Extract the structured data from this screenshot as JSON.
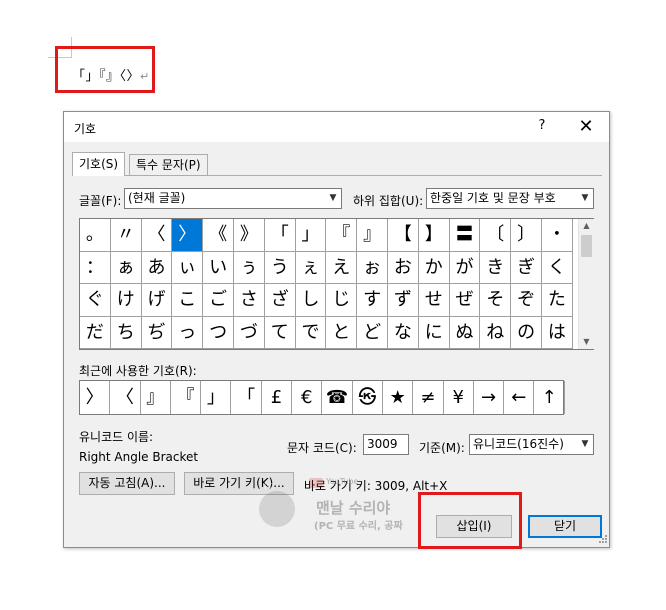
{
  "document": {
    "inserted_text": "「」『』〈〉",
    "paragraph_mark": "↵"
  },
  "dialog": {
    "title": "기호",
    "help": "?",
    "close": "✕",
    "tabs": [
      {
        "label": "기호(S)",
        "active": true
      },
      {
        "label": "특수 문자(P)",
        "active": false
      }
    ],
    "font_label": "글꼴(F):",
    "font_value": "(현재 글꼴)",
    "subset_label": "하위 집합(U):",
    "subset_value": "한중일 기호 및 문장 부호",
    "symbols": [
      [
        "。",
        "〃",
        "〈",
        "〉",
        "《",
        "》",
        "「",
        "」",
        "『",
        "』",
        "【",
        "】",
        "〓",
        "〔",
        "〕",
        "・"
      ],
      [
        "：",
        "ぁ",
        "あ",
        "ぃ",
        "い",
        "ぅ",
        "う",
        "ぇ",
        "え",
        "ぉ",
        "お",
        "か",
        "が",
        "き",
        "ぎ",
        "く"
      ],
      [
        "ぐ",
        "け",
        "げ",
        "こ",
        "ご",
        "さ",
        "ざ",
        "し",
        "じ",
        "す",
        "ず",
        "せ",
        "ぜ",
        "そ",
        "ぞ",
        "た"
      ],
      [
        "だ",
        "ち",
        "ぢ",
        "っ",
        "つ",
        "づ",
        "て",
        "で",
        "と",
        "ど",
        "な",
        "に",
        "ぬ",
        "ね",
        "の",
        "は"
      ]
    ],
    "selected": {
      "row": 0,
      "col": 3
    },
    "recent_label": "최근에 사용한 기호(R):",
    "recent": [
      "〉",
      "〈",
      "』",
      "『",
      "」",
      "「",
      "£",
      "€",
      "☎",
      "㉿",
      "★",
      "≠",
      "¥",
      "→",
      "←",
      "↑"
    ],
    "unicode_name_label": "유니코드 이름:",
    "unicode_name": "Right Angle Bracket",
    "char_code_label": "문자 코드(C):",
    "char_code": "3009",
    "basis_label": "기준(M):",
    "basis_value": "유니코드(16진수)",
    "autocorrect_button": "자동 고침(A)...",
    "shortcut_button": "바로 가기 키(K)...",
    "shortcut_text": "바로 가기 키: 3009, Alt+X",
    "insert_button": "삽입(I)",
    "close_button": "닫기"
  },
  "watermark": {
    "line1": "맨날 수리야",
    "line2": "(PC 무료 수리, 공짜",
    "badge": "YouTube",
    "logo_text": "PC"
  },
  "colors": {
    "highlight": "#e01a1a",
    "selection": "#0078d7"
  }
}
